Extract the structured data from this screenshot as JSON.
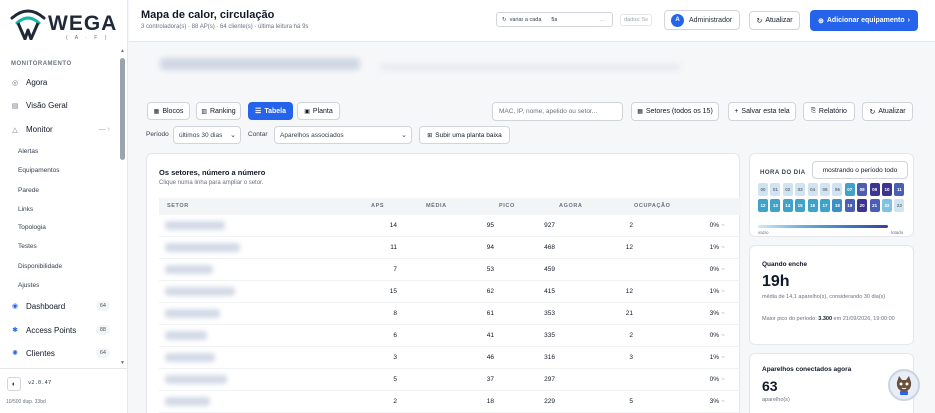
{
  "brand": {
    "word": "WEGA",
    "sub": "( A · F )"
  },
  "sidebar": {
    "section": "MONITORAMENTO",
    "items": [
      {
        "label": "Agora",
        "icon": "radio-icon"
      },
      {
        "label": "Visão Geral",
        "icon": "overview-icon"
      },
      {
        "label": "Monitor",
        "icon": "triangle-icon"
      }
    ],
    "monitor_sub": [
      "Alertas",
      "Equipamentos",
      "Parede",
      "Links",
      "Topologia",
      "Testes",
      "Disponibilidade",
      "Ajustes"
    ],
    "counted": [
      {
        "label": "Dashboard",
        "count": "64"
      },
      {
        "label": "Access Points",
        "count": "88"
      },
      {
        "label": "Clientes",
        "count": "64"
      }
    ],
    "version": "v2.0.47",
    "disp": "10/500 disp.  33bd"
  },
  "header": {
    "title": "Mapa de calor, circulação",
    "subtitle": "3 controladora(s) · 88 AP(s) · 64 cliente(s) · última leitura há 9s",
    "refresh_label": "variar a cada",
    "refresh_value": "5s",
    "dados": "dados: 5s",
    "admin": "Administrador",
    "admin_initial": "A",
    "atualizar": "Atualizar",
    "add": "Adicionar equipamento"
  },
  "toolbar": {
    "tabs": [
      "Blocos",
      "Ranking",
      "Tabela",
      "Planta"
    ],
    "search_placeholder": "MAC, IP, nome, apelido ou setor...",
    "setores": "Setores (todos os 15)",
    "salvar": "Salvar esta tela",
    "relatorio": "Relatório",
    "atualizar": "Atualizar",
    "periodo_label": "Período",
    "periodo_value": "últimos 30 dias",
    "contar_label": "Contar",
    "contar_value": "Aparelhos associados",
    "subir": "Subir uma planta baixa"
  },
  "table": {
    "title": "Os setores, número a número",
    "subtitle": "Clique numa linha para ampliar o setor.",
    "headers": [
      "SETOR",
      "APS",
      "MÉDIA",
      "PICO",
      "AGORA",
      "OCUPAÇÃO"
    ],
    "rows": [
      {
        "aps": "14",
        "media": "95",
        "pico": "927",
        "agora": "2",
        "ocup": "0%"
      },
      {
        "aps": "11",
        "media": "94",
        "pico": "468",
        "agora": "12",
        "ocup": "1%"
      },
      {
        "aps": "7",
        "media": "53",
        "pico": "459",
        "agora": "",
        "ocup": "0%"
      },
      {
        "aps": "15",
        "media": "62",
        "pico": "415",
        "agora": "12",
        "ocup": "1%"
      },
      {
        "aps": "8",
        "media": "61",
        "pico": "353",
        "agora": "21",
        "ocup": "3%"
      },
      {
        "aps": "6",
        "media": "41",
        "pico": "335",
        "agora": "2",
        "ocup": "0%"
      },
      {
        "aps": "3",
        "media": "46",
        "pico": "316",
        "agora": "3",
        "ocup": "1%"
      },
      {
        "aps": "5",
        "media": "37",
        "pico": "297",
        "agora": "",
        "ocup": "0%"
      },
      {
        "aps": "2",
        "media": "18",
        "pico": "229",
        "agora": "5",
        "ocup": "3%"
      }
    ]
  },
  "heat": {
    "label": "HORA DO DIA",
    "period": "mostrando o período todo",
    "row1": [
      "00",
      "01",
      "02",
      "03",
      "04",
      "05",
      "06",
      "07",
      "08",
      "09",
      "10",
      "11"
    ],
    "row2": [
      "12",
      "13",
      "14",
      "15",
      "16",
      "17",
      "18",
      "19",
      "20",
      "21",
      "22",
      "23"
    ],
    "levels1": [
      0.05,
      0.05,
      0.05,
      0.05,
      0.05,
      0.05,
      0.1,
      0.4,
      0.7,
      0.85,
      0.8,
      0.75
    ],
    "levels2": [
      0.5,
      0.5,
      0.5,
      0.45,
      0.45,
      0.5,
      0.6,
      0.75,
      0.8,
      0.75,
      0.3,
      0.1
    ],
    "low": "vazio",
    "high": "lotado"
  },
  "kpi1": {
    "title": "Quando enche",
    "value": "19h",
    "line1": "média de 14,1 aparelho(s), considerando 30 dia(s)",
    "line2a": "Maior pico do período: ",
    "peak": "3.300",
    "line2b": " em 21/09/2026, 19:00:00"
  },
  "kpi2": {
    "title": "Aparelhos conectados agora",
    "value": "63",
    "unit": "aparelho(s)"
  },
  "colors": {
    "accent": "#2563eb"
  }
}
